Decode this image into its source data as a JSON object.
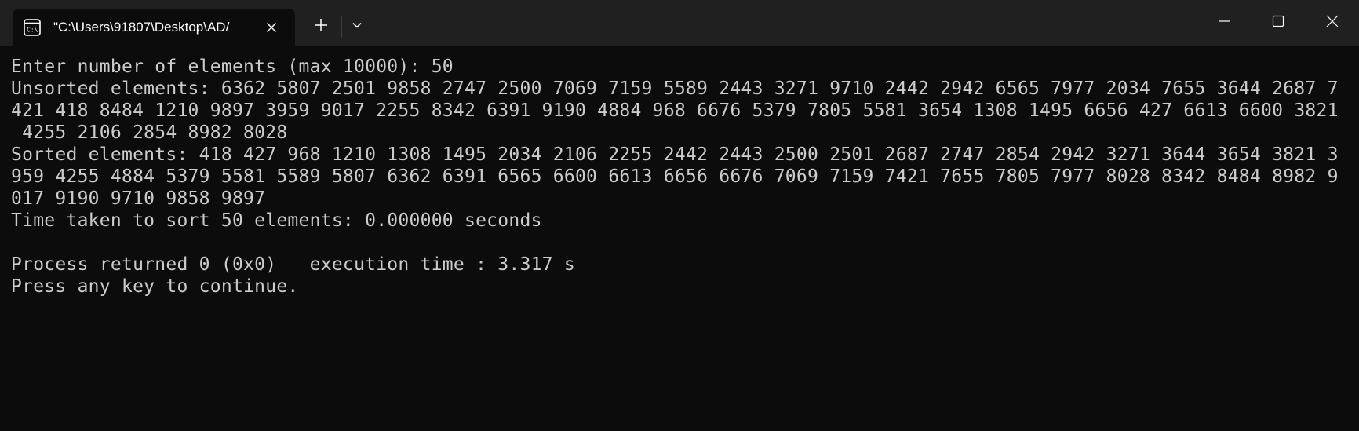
{
  "window": {
    "tab_title": "\"C:\\Users\\91807\\Desktop\\AD/",
    "tab_icon": "console-icon",
    "new_tab_icon": "plus-icon",
    "dropdown_icon": "chevron-down-icon",
    "minimize_icon": "minimize-icon",
    "maximize_icon": "maximize-icon",
    "close_icon": "close-icon"
  },
  "colors": {
    "titlebar_bg": "#202020",
    "console_bg": "#0c0c0c",
    "console_text": "#cccccc",
    "tab_text": "#ffffff"
  },
  "console": {
    "lines": [
      "Enter number of elements (max 10000): 50",
      "Unsorted elements: 6362 5807 2501 9858 2747 2500 7069 7159 5589 2443 3271 9710 2442 2942 6565 7977 2034 7655 3644 2687 7",
      "421 418 8484 1210 9897 3959 9017 2255 8342 6391 9190 4884 968 6676 5379 7805 5581 3654 1308 1495 6656 427 6613 6600 3821",
      " 4255 2106 2854 8982 8028",
      "Sorted elements: 418 427 968 1210 1308 1495 2034 2106 2255 2442 2443 2500 2501 2687 2747 2854 2942 3271 3644 3654 3821 3",
      "959 4255 4884 5379 5581 5589 5807 6362 6391 6565 6600 6613 6656 6676 7069 7159 7421 7655 7805 7977 8028 8342 8484 8982 9",
      "017 9190 9710 9858 9897",
      "Time taken to sort 50 elements: 0.000000 seconds",
      "",
      "Process returned 0 (0x0)   execution time : 3.317 s",
      "Press any key to continue."
    ]
  }
}
